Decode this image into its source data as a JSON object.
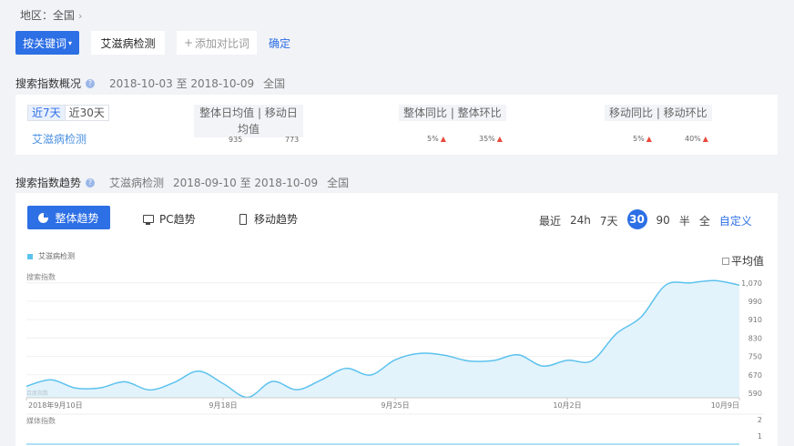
{
  "region": {
    "label": "地区：",
    "value": "全国"
  },
  "keywords": {
    "by_keyword_label": "按关键词",
    "active_keyword": "艾滋病检测",
    "add_compare_label": "添加对比词",
    "confirm_label": "确定"
  },
  "overview": {
    "title": "搜索指数概况",
    "date_range": "2018-10-03 至 2018-10-09",
    "region": "全国",
    "period_tabs": [
      "近7天",
      "近30天"
    ],
    "keyword": "艾滋病检测",
    "col_avg": "整体日均值 | 移动日均值",
    "col_yoy": "整体同比 | 整体环比",
    "col_mobile": "移动同比 | 移动环比",
    "overall_avg": "935",
    "mobile_avg": "773",
    "overall_yoy": "5%",
    "overall_mom": "35%",
    "mobile_yoy": "5%",
    "mobile_mom": "40%"
  },
  "trend": {
    "title": "搜索指数趋势",
    "keyword": "艾滋病检测",
    "date_range": "2018-09-10 至 2018-10-09",
    "region": "全国",
    "tabs": {
      "overall": "整体趋势",
      "pc": "PC趋势",
      "mobile": "移动趋势"
    },
    "range_options": [
      "最近",
      "24h",
      "7天",
      "30",
      "90",
      "半",
      "全"
    ],
    "range_selected": "30",
    "custom_label": "自定义",
    "avg_label": "平均值",
    "media_label": "媒体指数",
    "media_ticks": [
      "2",
      "1"
    ]
  },
  "chart_data": {
    "type": "area",
    "series": [
      {
        "name": "艾滋病检测",
        "color": "#5cc2ee",
        "values": [
          620,
          648,
          612,
          613,
          640,
          604,
          636,
          686,
          632,
          572,
          641,
          605,
          648,
          698,
          669,
          735,
          763,
          755,
          730,
          732,
          757,
          708,
          733,
          731,
          849,
          921,
          1060,
          1070,
          1080,
          1060
        ]
      }
    ],
    "ylabel": "搜索指数",
    "y_ticks": [
      "1,070",
      "990",
      "910",
      "830",
      "750",
      "670",
      "590"
    ],
    "ylim": [
      570,
      1085
    ],
    "x_tick_labels": [
      "2018年9月10日",
      "9月18日",
      "9月25日",
      "10月2日",
      "10月9日"
    ],
    "x_tick_index": [
      0,
      8,
      15,
      22,
      29
    ],
    "watermark": "百度指数"
  }
}
